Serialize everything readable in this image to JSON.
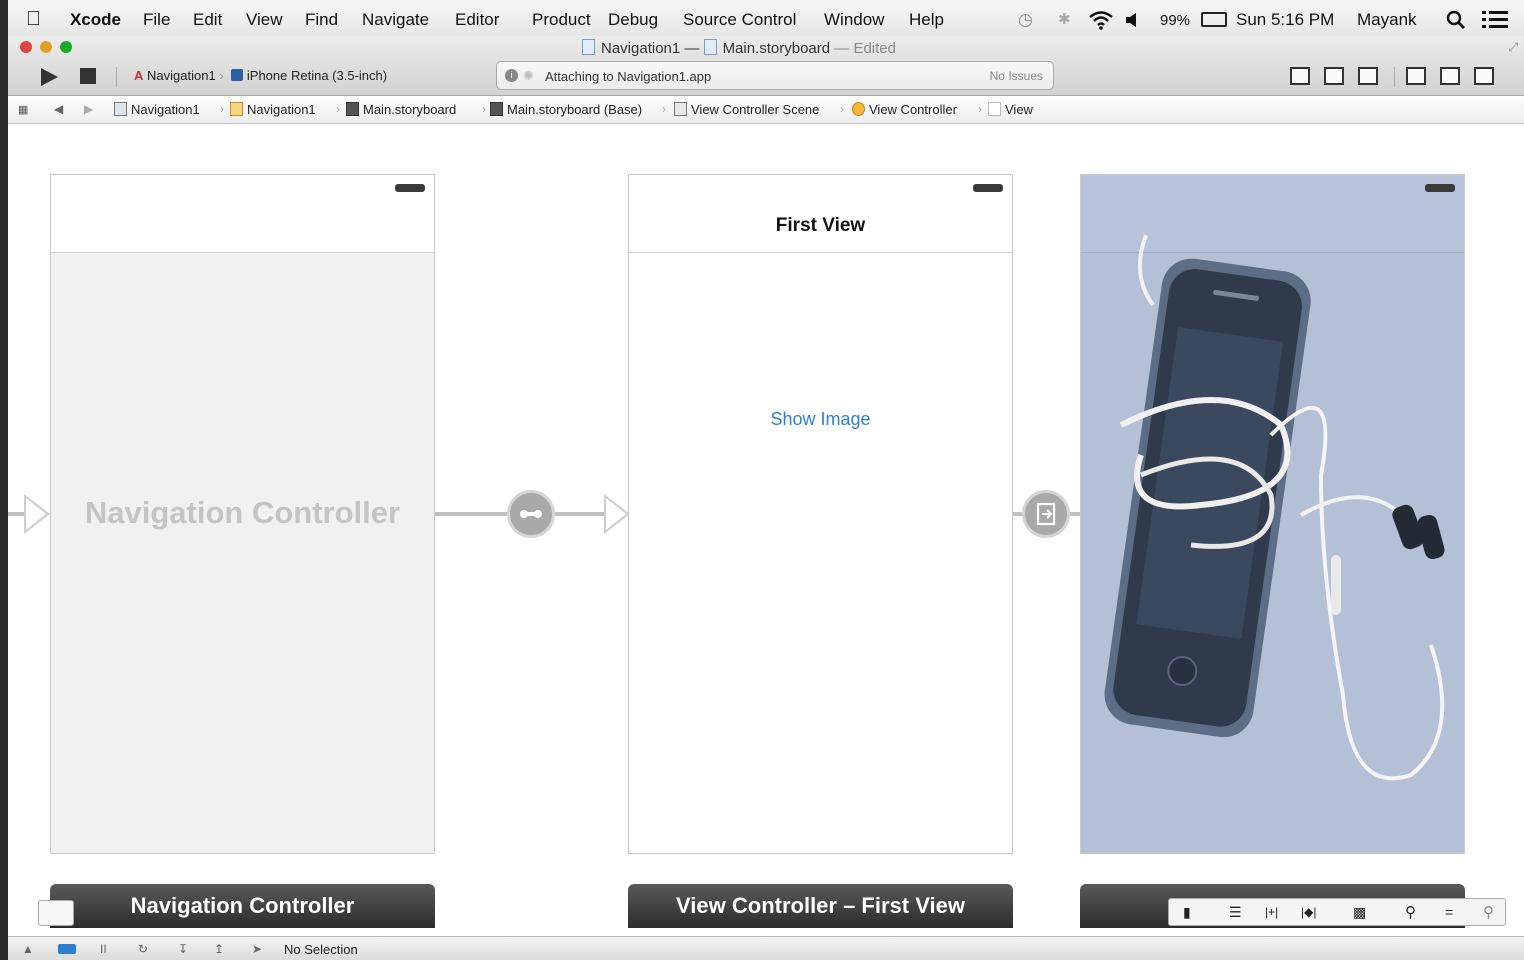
{
  "menubar": {
    "app": "Xcode",
    "menus": [
      "File",
      "Edit",
      "View",
      "Find",
      "Navigate",
      "Editor",
      "Product",
      "Debug",
      "Source Control",
      "Window",
      "Help"
    ],
    "battery": "99%",
    "clock": "Sun 5:16 PM",
    "user": "Mayank"
  },
  "window": {
    "project": "Navigation1",
    "dash": "—",
    "file": "Main.storyboard",
    "edited": "— Edited"
  },
  "toolbar": {
    "scheme": "Navigation1",
    "device": "iPhone Retina (3.5-inch)",
    "activity": "Attaching to Navigation1.app",
    "issues": "No Issues"
  },
  "jumpbar": {
    "crumbs": [
      "Navigation1",
      "Navigation1",
      "Main.storyboard",
      "Main.storyboard (Base)",
      "View Controller Scene",
      "View Controller",
      "View"
    ]
  },
  "canvas": {
    "nav_controller_watermark": "Navigation Controller",
    "nav_controller_footer": "Navigation Controller",
    "first_view_title": "First View",
    "show_image_button": "Show Image",
    "view_controller_footer": "View Controller – First View"
  },
  "debugbar": {
    "selection": "No Selection"
  },
  "colors": {
    "link_blue": "#2f7fd1",
    "image_tint": "#b3c0d6",
    "close": "#e0443e",
    "minimize": "#dea123",
    "zoom": "#1aab29"
  },
  "icons": [
    "apple-icon",
    "run-icon",
    "stop-icon",
    "search-icon",
    "list-icon",
    "wifi-icon",
    "bluetooth-icon",
    "volume-icon",
    "time-machine-icon",
    "zoom-in-icon"
  ]
}
